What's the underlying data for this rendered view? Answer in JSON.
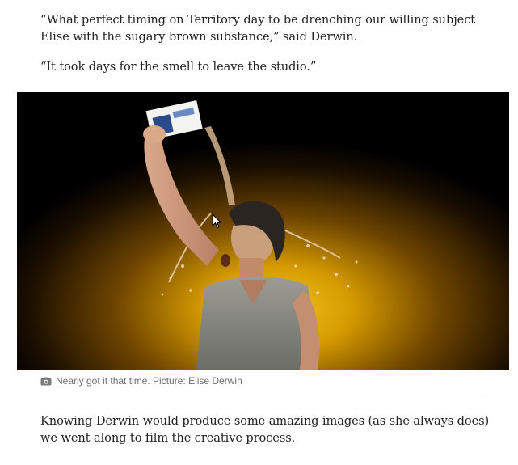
{
  "article": {
    "paragraph_1": "“What perfect timing on Territory day to be drenching our willing subject Elise with the sugary brown substance,” said Derwin.",
    "paragraph_2": "“It took days for the smell to leave the studio.”",
    "caption": "Nearly got it that time. Picture: Elise Derwin",
    "paragraph_3": "Knowing Derwin would produce some amazing images (as she always does) we went along to film the creative process."
  },
  "icons": {
    "caption_icon": "camera-icon",
    "cursor": "mouse-pointer-icon"
  },
  "colors": {
    "text": "#222222",
    "caption": "#6e6e6e",
    "photo_glow": "#e0a400",
    "photo_background": "#000000"
  }
}
